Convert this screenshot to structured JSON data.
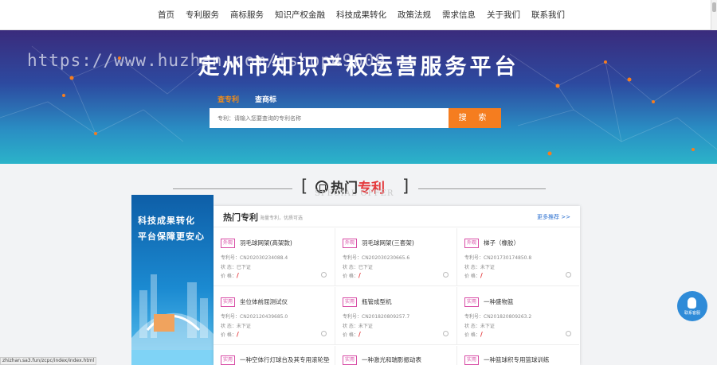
{
  "nav": [
    "首页",
    "专利服务",
    "商标服务",
    "知识产权金融",
    "科技成果转化",
    "政策法规",
    "需求信息",
    "关于我们",
    "联系我们"
  ],
  "hero": {
    "title": "定州市知识产权运营服务平台",
    "watermark": "https://www.huzhan.com/ishop49609",
    "tabs": [
      "查专利",
      "查商标"
    ],
    "search_placeholder": "专利：请输入您要查询的专利名称",
    "search_button": "搜 索"
  },
  "section": {
    "title_black": "热门",
    "title_red": "专利",
    "subtitle": "SPECIAL OFFER",
    "bracket_left": "[",
    "bracket_right": "]"
  },
  "banner": {
    "line1": "科技成果转化",
    "line2": "平台保障更安心"
  },
  "panel": {
    "title": "热门专利",
    "subtitle": "海量专利，优质可选",
    "more": "更多推荐 >>"
  },
  "cards": [
    {
      "tag": "外观",
      "name": "羽毛球网架(高架款)",
      "number": "专利号：CN202030234088.4",
      "status": "状 态：已下证",
      "price_label": "价 格：",
      "price": "/"
    },
    {
      "tag": "外观",
      "name": "羽毛球网架(三套架)",
      "number": "专利号：CN202030230665.6",
      "status": "状 态：已下证",
      "price_label": "价 格：",
      "price": "/"
    },
    {
      "tag": "外观",
      "name": "梯子（橡胶）",
      "number": "专利号：CN201730174850.8",
      "status": "状 态：未下证",
      "price_label": "价 格：",
      "price": "/"
    },
    {
      "tag": "实用",
      "name": "坐位体前屈测试仪",
      "number": "专利号：CN202120439685.0",
      "status": "状 态：未下证",
      "price_label": "价 格：",
      "price": "/"
    },
    {
      "tag": "实用",
      "name": "瓶管成型机",
      "number": "专利号：CN201820809257.7",
      "status": "状 态：未下证",
      "price_label": "价 格：",
      "price": "/"
    },
    {
      "tag": "实用",
      "name": "一种盛物篮",
      "number": "专利号：CN201820809263.2",
      "status": "状 态：未下证",
      "price_label": "价 格：",
      "price": "/"
    },
    {
      "tag": "实用",
      "name": "一种空体行灯球台及其专用滚轮垫",
      "number": "",
      "status": "",
      "price_label": "",
      "price": ""
    },
    {
      "tag": "实用",
      "name": "一种激光和瑞影振动表",
      "number": "",
      "status": "",
      "price_label": "",
      "price": ""
    },
    {
      "tag": "实用",
      "name": "一种篮球积专用篮球训练",
      "number": "",
      "status": "",
      "price_label": "",
      "price": ""
    }
  ],
  "float": {
    "label": "联系客服"
  },
  "status_url": "zhizhan.sa3.fun/zcpc/index/index.html",
  "colors": {
    "accent": "#f57d1f",
    "red": "#e4393c",
    "tag": "#d84ca6",
    "link": "#2a6fd0"
  }
}
